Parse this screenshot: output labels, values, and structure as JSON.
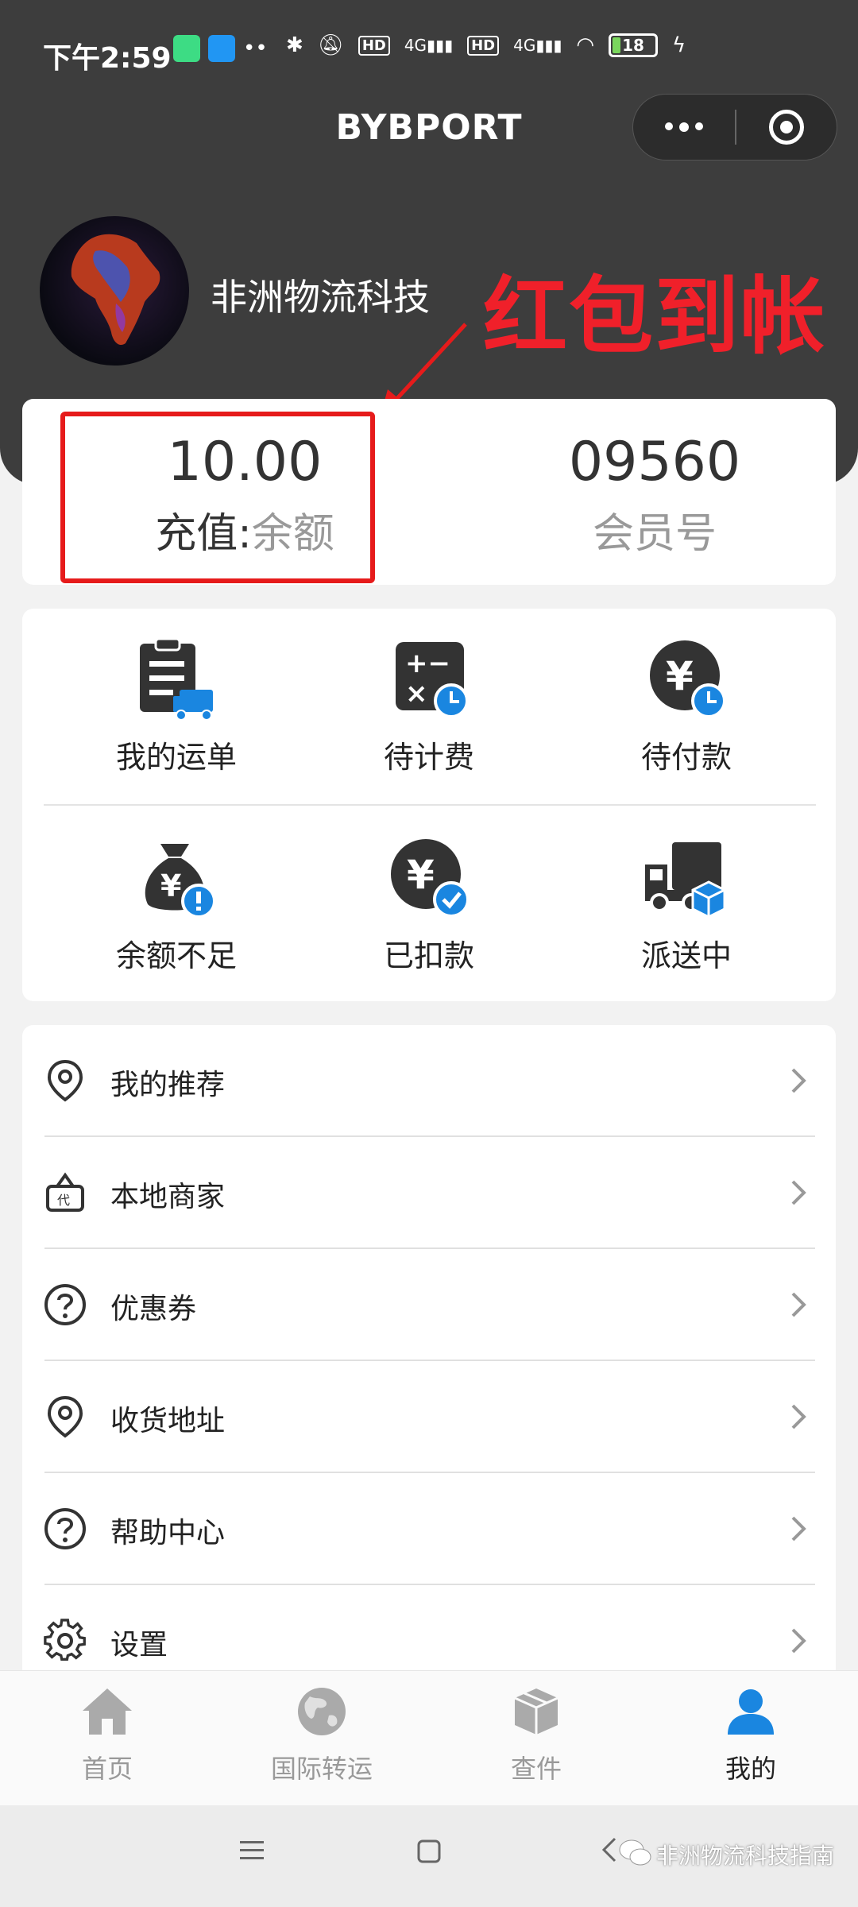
{
  "status_bar": {
    "time": "下午2:59",
    "battery": "18"
  },
  "nav": {
    "title": "BYBPORT"
  },
  "profile": {
    "username": "非洲物流科技"
  },
  "annotation": {
    "text": "红包到帐"
  },
  "stats": {
    "balance_value": "10.00",
    "balance_label_prefix": "充值:",
    "balance_label_suffix": "余额",
    "member_value": "09560",
    "member_label": "会员号"
  },
  "orders": [
    {
      "label": "我的运单",
      "icon": "waybill-icon"
    },
    {
      "label": "待计费",
      "icon": "calculator-icon"
    },
    {
      "label": "待付款",
      "icon": "yen-clock-icon"
    },
    {
      "label": "余额不足",
      "icon": "money-bag-alert-icon"
    },
    {
      "label": "已扣款",
      "icon": "yen-check-icon"
    },
    {
      "label": "派送中",
      "icon": "delivery-truck-icon"
    }
  ],
  "menu": [
    {
      "label": "我的推荐",
      "icon": "location-pin-icon"
    },
    {
      "label": "本地商家",
      "icon": "shopping-basket-icon"
    },
    {
      "label": "优惠券",
      "icon": "question-circle-icon"
    },
    {
      "label": "收货地址",
      "icon": "location-pin-icon"
    },
    {
      "label": "帮助中心",
      "icon": "question-circle-icon"
    },
    {
      "label": "设置",
      "icon": "gear-icon"
    }
  ],
  "tabbar": [
    {
      "label": "首页",
      "icon": "home-icon"
    },
    {
      "label": "国际转运",
      "icon": "globe-icon"
    },
    {
      "label": "查件",
      "icon": "package-icon"
    },
    {
      "label": "我的",
      "icon": "user-icon"
    }
  ],
  "watermark": "非洲物流科技指南",
  "colors": {
    "header_bg": "#3d3d3d",
    "accent_blue": "#1a86e0",
    "annotation_red": "#f0202a",
    "icon_dark": "#333333"
  }
}
